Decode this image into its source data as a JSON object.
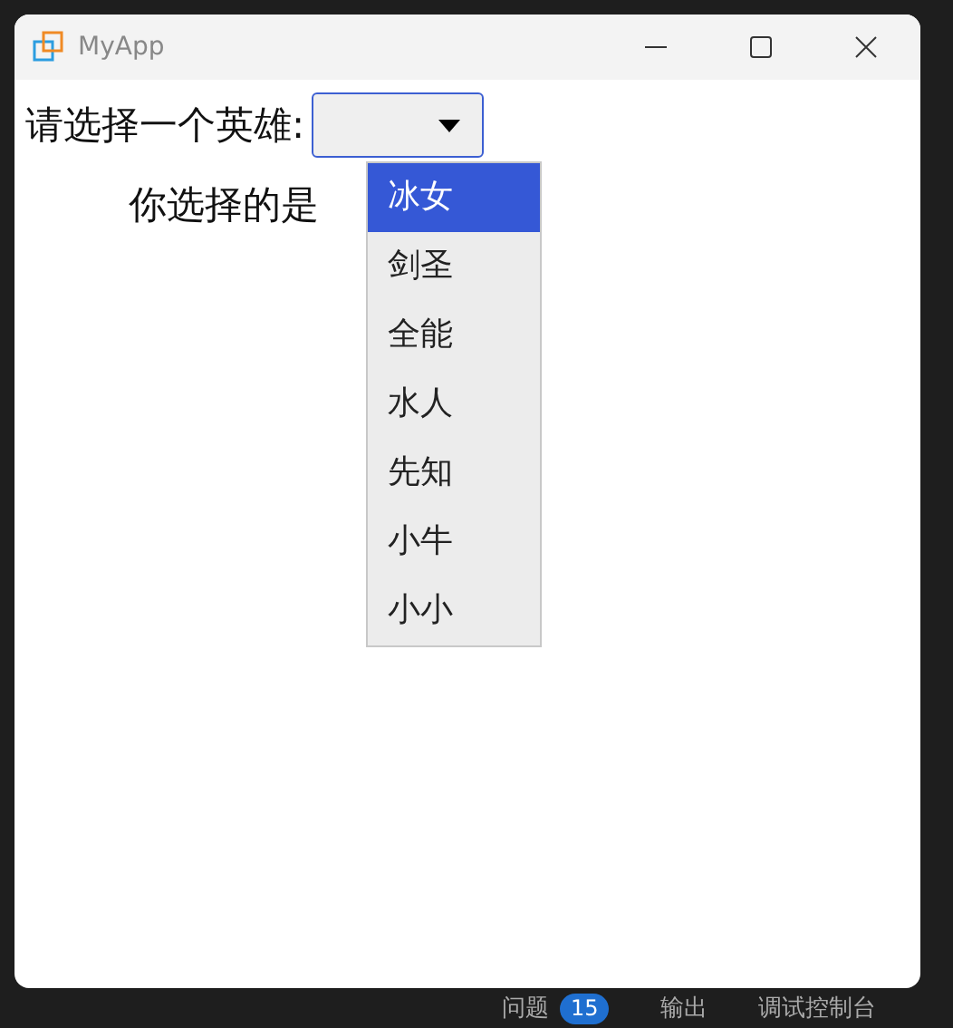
{
  "window": {
    "title": "MyApp"
  },
  "form": {
    "label": "请选择一个英雄:",
    "result_label": "你选择的是",
    "dropdown": {
      "expanded": true,
      "options": [
        {
          "label": "冰女",
          "selected": true
        },
        {
          "label": "剑圣",
          "selected": false
        },
        {
          "label": "全能",
          "selected": false
        },
        {
          "label": "水人",
          "selected": false
        },
        {
          "label": "先知",
          "selected": false
        },
        {
          "label": "小牛",
          "selected": false
        },
        {
          "label": "小小",
          "selected": false
        }
      ]
    }
  },
  "panel_tabs": [
    {
      "label": "问题",
      "badge": "15"
    },
    {
      "label": "输出"
    },
    {
      "label": "调试控制台"
    }
  ]
}
